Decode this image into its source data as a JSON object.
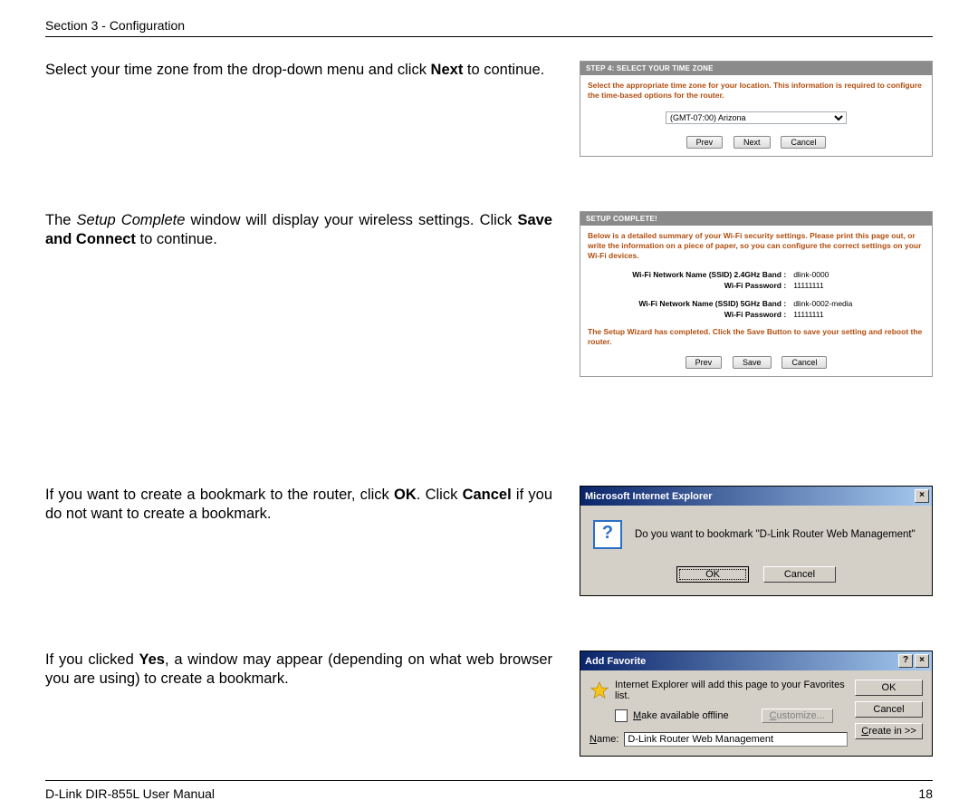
{
  "header": "Section 3 - Configuration",
  "footer_left": "D-Link DIR-855L User Manual",
  "footer_right": "18",
  "para1_a": "Select your time zone from the drop-down menu and click ",
  "para1_b": "Next",
  "para1_c": " to continue.",
  "para2_a": "The ",
  "para2_b": "Setup Complete",
  "para2_c": " window will display your wireless settings. Click ",
  "para2_d": "Save and Connect",
  "para2_e": " to continue.",
  "para3_a": "If you want to create a bookmark to the router, click ",
  "para3_b": "OK",
  "para3_c": ". Click ",
  "para3_d": "Cancel",
  "para3_e": " if you do not want to create a bookmark.",
  "para4_a": "If you clicked ",
  "para4_b": "Yes",
  "para4_c": ", a window may appear (depending on what web browser you are using) to create a bookmark.",
  "step4": {
    "title": "STEP 4: SELECT YOUR TIME ZONE",
    "intro": "Select the appropriate time zone for your location. This information is required to configure the time-based options for the router.",
    "tz_value": "(GMT-07:00) Arizona",
    "prev": "Prev",
    "next": "Next",
    "cancel": "Cancel"
  },
  "complete": {
    "title": "SETUP COMPLETE!",
    "intro": "Below is a detailed summary of your Wi-Fi security settings. Please print this page out, or write the information on a piece of paper, so you can configure the correct settings on your Wi-Fi devices.",
    "l1": "Wi-Fi Network Name (SSID) 2.4GHz Band :",
    "v1": "dlink-0000",
    "l2": "Wi-Fi Password :",
    "v2": "11111111",
    "l3": "Wi-Fi Network Name (SSID) 5GHz Band :",
    "v3": "dlink-0002-media",
    "l4": "Wi-Fi Password :",
    "v4": "11111111",
    "note": "The Setup Wizard has completed. Click the Save Button to save your setting and reboot the router.",
    "prev": "Prev",
    "save": "Save",
    "cancel": "Cancel"
  },
  "iedlg": {
    "title": "Microsoft Internet Explorer",
    "msg": "Do you want to bookmark \"D-Link Router Web Management\"",
    "ok": "OK",
    "cancel": "Cancel"
  },
  "fav": {
    "title": "Add Favorite",
    "line1": "Internet Explorer will add this page to your Favorites list.",
    "make_offline_pre": "M",
    "make_offline_suf": "ake available offline",
    "customize_pre": "C",
    "customize_suf": "ustomize...",
    "name_pre": "N",
    "name_suf": "ame:",
    "name_value": "D-Link Router Web Management",
    "ok": "OK",
    "cancel": "Cancel",
    "create_pre": "C",
    "create_suf": "reate in >>"
  }
}
